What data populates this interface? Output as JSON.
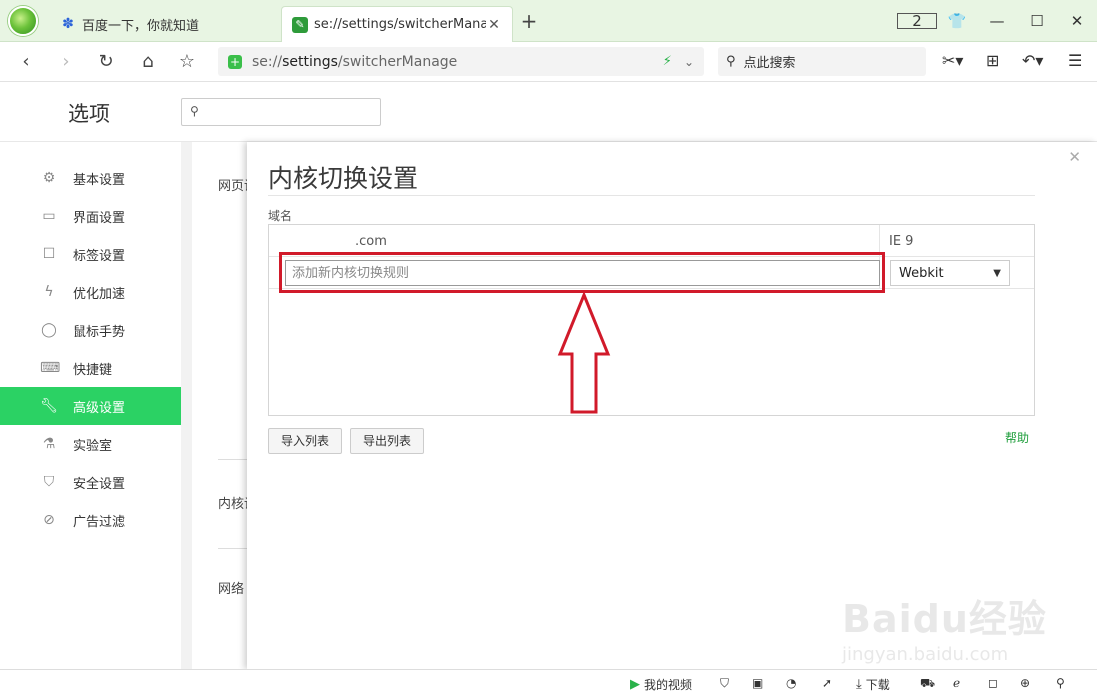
{
  "colors": {
    "accent": "#2bd264",
    "tabbar_bg": "#e8f5e3",
    "highlight": "#d11a2a",
    "help_link": "#1f9e3c"
  },
  "tabs": [
    {
      "title": "百度一下，你就知道",
      "icon": "baidu-paw-icon"
    },
    {
      "title": "se://settings/switcherManage",
      "icon": "wrench-icon",
      "active": true
    }
  ],
  "window": {
    "tab_count": "2"
  },
  "address": {
    "scheme": "se://",
    "host": "settings",
    "path": "/switcherManage"
  },
  "search": {
    "placeholder": "点此搜索"
  },
  "settings": {
    "title": "选项",
    "search_placeholder": ""
  },
  "sidebar": {
    "items": [
      {
        "label": "基本设置",
        "icon": "gear-icon"
      },
      {
        "label": "界面设置",
        "icon": "window-icon"
      },
      {
        "label": "标签设置",
        "icon": "tab-icon"
      },
      {
        "label": "优化加速",
        "icon": "lightning-icon"
      },
      {
        "label": "鼠标手势",
        "icon": "mouse-icon"
      },
      {
        "label": "快捷键",
        "icon": "keyboard-icon"
      },
      {
        "label": "高级设置",
        "icon": "wrench-icon",
        "active": true
      },
      {
        "label": "实验室",
        "icon": "flask-icon"
      },
      {
        "label": "安全设置",
        "icon": "shield-icon"
      },
      {
        "label": "广告过滤",
        "icon": "block-icon"
      }
    ]
  },
  "background": {
    "label_1": "网页设",
    "label_2": "内核设",
    "label_3": "网络"
  },
  "modal": {
    "title": "内核切换设置",
    "field_label": "域名",
    "rules": [
      {
        "domain": ".com",
        "engine": "IE 9"
      }
    ],
    "new_rule_placeholder": "添加新内核切换规则",
    "engine_selected": "Webkit",
    "import_label": "导入列表",
    "export_label": "导出列表",
    "help_label": "帮助"
  },
  "statusbar": {
    "video_label": "我的视频",
    "download_label": "下载"
  },
  "watermark": {
    "logo": "Baidu经验",
    "sub": "jingyan.baidu.com"
  }
}
